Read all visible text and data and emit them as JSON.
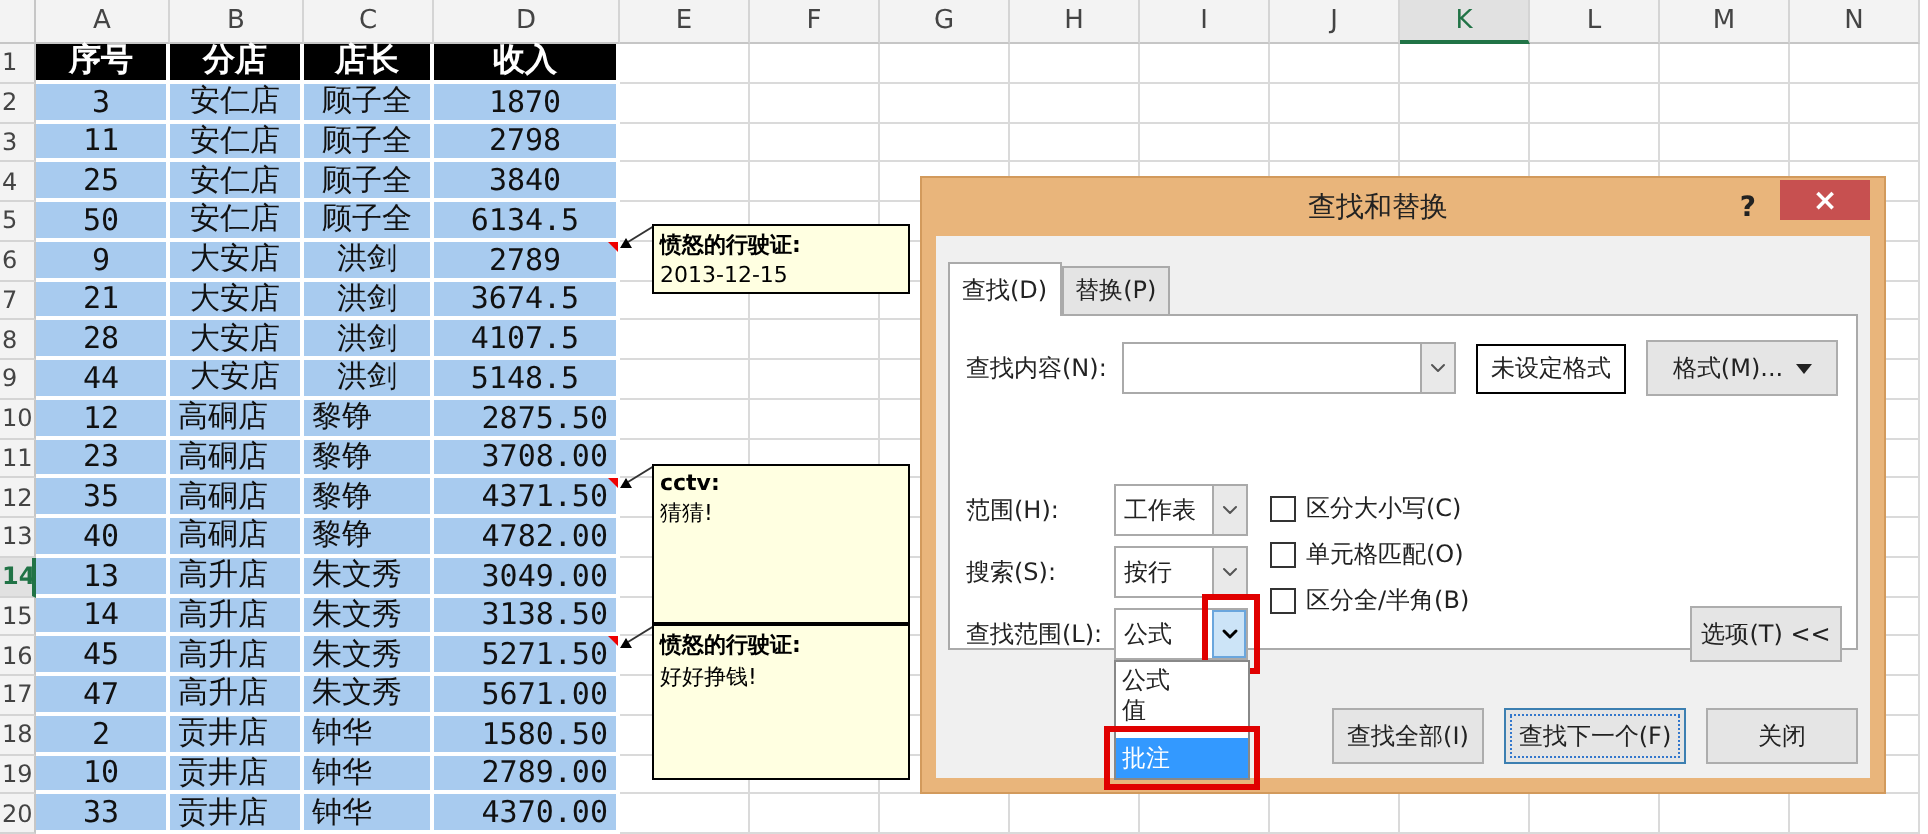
{
  "sheet": {
    "columns": [
      {
        "label": "A",
        "selected": false
      },
      {
        "label": "B",
        "selected": false
      },
      {
        "label": "C",
        "selected": false
      },
      {
        "label": "D",
        "selected": false
      },
      {
        "label": "E",
        "selected": false
      },
      {
        "label": "F",
        "selected": false
      },
      {
        "label": "G",
        "selected": false
      },
      {
        "label": "H",
        "selected": false
      },
      {
        "label": "I",
        "selected": false
      },
      {
        "label": "J",
        "selected": false
      },
      {
        "label": "K",
        "selected": true
      },
      {
        "label": "L",
        "selected": false
      },
      {
        "label": "M",
        "selected": false
      },
      {
        "label": "N",
        "selected": false
      }
    ],
    "rows": [
      {
        "number": "1",
        "selected": false,
        "kind": "header",
        "comment": false,
        "cells": [
          "序号",
          "分店",
          "店长",
          "收入"
        ]
      },
      {
        "number": "2",
        "selected": false,
        "kind": "centered",
        "comment": false,
        "cells": [
          "3",
          "安仁店",
          "顾子全",
          "1870"
        ]
      },
      {
        "number": "3",
        "selected": false,
        "kind": "centered",
        "comment": false,
        "cells": [
          "11",
          "安仁店",
          "顾子全",
          "2798"
        ]
      },
      {
        "number": "4",
        "selected": false,
        "kind": "centered",
        "comment": false,
        "cells": [
          "25",
          "安仁店",
          "顾子全",
          "3840"
        ]
      },
      {
        "number": "5",
        "selected": false,
        "kind": "centered",
        "comment": false,
        "cells": [
          "50",
          "安仁店",
          "顾子全",
          "6134.5"
        ]
      },
      {
        "number": "6",
        "selected": false,
        "kind": "centered",
        "comment": true,
        "cells": [
          "9",
          "大安店",
          "洪剑",
          "2789"
        ]
      },
      {
        "number": "7",
        "selected": false,
        "kind": "centered",
        "comment": false,
        "cells": [
          "21",
          "大安店",
          "洪剑",
          "3674.5"
        ]
      },
      {
        "number": "8",
        "selected": false,
        "kind": "centered",
        "comment": false,
        "cells": [
          "28",
          "大安店",
          "洪剑",
          "4107.5"
        ]
      },
      {
        "number": "9",
        "selected": false,
        "kind": "centered",
        "comment": false,
        "cells": [
          "44",
          "大安店",
          "洪剑",
          "5148.5"
        ]
      },
      {
        "number": "10",
        "selected": false,
        "kind": "plain",
        "comment": false,
        "cells": [
          "12",
          "高硐店",
          "黎铮",
          "2875.50"
        ]
      },
      {
        "number": "11",
        "selected": false,
        "kind": "plain",
        "comment": false,
        "cells": [
          "23",
          "高硐店",
          "黎铮",
          "3708.00"
        ]
      },
      {
        "number": "12",
        "selected": false,
        "kind": "plain",
        "comment": true,
        "cells": [
          "35",
          "高硐店",
          "黎铮",
          "4371.50"
        ]
      },
      {
        "number": "13",
        "selected": false,
        "kind": "plain",
        "comment": false,
        "cells": [
          "40",
          "高硐店",
          "黎铮",
          "4782.00"
        ]
      },
      {
        "number": "14",
        "selected": true,
        "kind": "plain",
        "comment": false,
        "cells": [
          "13",
          "高升店",
          "朱文秀",
          "3049.00"
        ]
      },
      {
        "number": "15",
        "selected": false,
        "kind": "plain",
        "comment": false,
        "cells": [
          "14",
          "高升店",
          "朱文秀",
          "3138.50"
        ]
      },
      {
        "number": "16",
        "selected": false,
        "kind": "plain",
        "comment": true,
        "cells": [
          "45",
          "高升店",
          "朱文秀",
          "5271.50"
        ]
      },
      {
        "number": "17",
        "selected": false,
        "kind": "plain",
        "comment": false,
        "cells": [
          "47",
          "高升店",
          "朱文秀",
          "5671.00"
        ]
      },
      {
        "number": "18",
        "selected": false,
        "kind": "plain",
        "comment": false,
        "cells": [
          "2",
          "贡井店",
          "钟华",
          "1580.50"
        ]
      },
      {
        "number": "19",
        "selected": false,
        "kind": "plain",
        "comment": false,
        "cells": [
          "10",
          "贡井店",
          "钟华",
          "2789.00"
        ]
      },
      {
        "number": "20",
        "selected": false,
        "kind": "plain",
        "comment": false,
        "cells": [
          "33",
          "贡井店",
          "钟华",
          "4370.00"
        ]
      }
    ]
  },
  "comments": [
    {
      "author": "愤怒的行驶证:",
      "text": "2013-12-15"
    },
    {
      "author": "cctv:",
      "text": "猜猜!"
    },
    {
      "author": "愤怒的行驶证:",
      "text": "好好挣钱!"
    }
  ],
  "dialog": {
    "title": "查找和替换",
    "help": "?",
    "close": "×",
    "tabs": [
      {
        "label": "查找(D)",
        "selected": true
      },
      {
        "label": "替换(P)",
        "selected": false
      }
    ],
    "find_label": "查找内容(N):",
    "format_preview": "未设定格式",
    "format_button": "格式(M)...",
    "options": [
      {
        "label": "范围(H):",
        "value": "工作表",
        "expanded": false,
        "highlighted": false
      },
      {
        "label": "搜索(S):",
        "value": "按行",
        "expanded": false,
        "highlighted": false
      },
      {
        "label": "查找范围(L):",
        "value": "公式",
        "expanded": true,
        "highlighted": true
      }
    ],
    "dropdown": [
      {
        "label": "公式",
        "selected": false,
        "highlighted": false
      },
      {
        "label": "值",
        "selected": false,
        "highlighted": false
      },
      {
        "label": "批注",
        "selected": true,
        "highlighted": true
      }
    ],
    "checkboxes": [
      {
        "label": "区分大小写(C)",
        "checked": false
      },
      {
        "label": "单元格匹配(O)",
        "checked": false
      },
      {
        "label": "区分全/半角(B)",
        "checked": false
      }
    ],
    "options_button": "选项(T) <<",
    "buttons": [
      {
        "label": "查找全部(I)",
        "focused": false
      },
      {
        "label": "查找下一个(F)",
        "focused": true
      },
      {
        "label": "关闭",
        "focused": false
      }
    ]
  }
}
